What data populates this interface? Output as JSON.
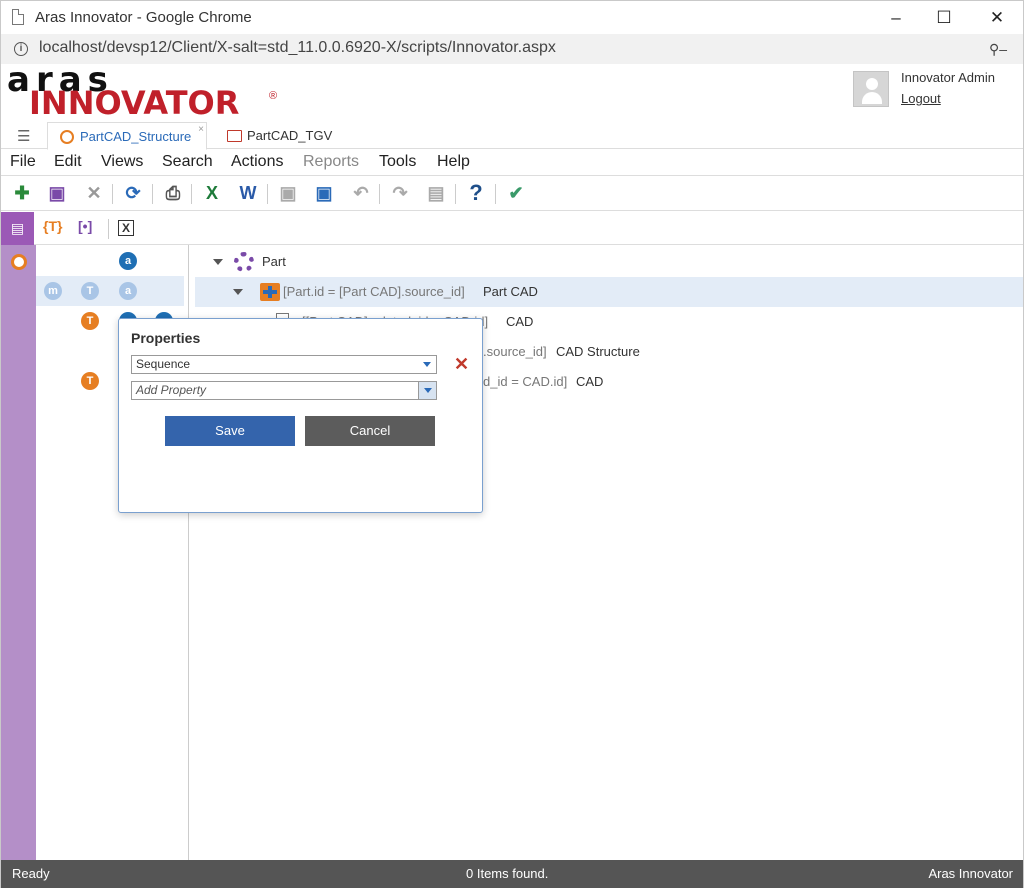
{
  "browser": {
    "title": "Aras Innovator - Google Chrome",
    "url": "localhost/devsp12/Client/X-salt=std_11.0.0.6920-X/scripts/Innovator.aspx"
  },
  "logo": {
    "top": "aras",
    "bottom": "INNOVATOR",
    "reg": "®"
  },
  "user": {
    "name": "Innovator Admin",
    "logout": "Logout"
  },
  "tabs": [
    {
      "label": "PartCAD_Structure",
      "close": "×"
    },
    {
      "label": "PartCAD_TGV"
    }
  ],
  "menu": [
    "File",
    "Edit",
    "Views",
    "Search",
    "Actions",
    "Reports",
    "Tools",
    "Help"
  ],
  "subtoolbar": {
    "t1": "{T}",
    "t2": "[•]",
    "t3": "X"
  },
  "left_icons": {
    "a": "a",
    "m": "m",
    "t": "T"
  },
  "tree": [
    {
      "label": "Part"
    },
    {
      "condition": "[Part.id = [Part CAD].source_id]",
      "label": "Part CAD"
    },
    {
      "condition": "[[Part CAD].related_id = CAD.id]",
      "label": "CAD"
    },
    {
      "condition": ".source_id]",
      "label": "CAD Structure"
    },
    {
      "condition": "d_id = CAD.id]",
      "label": "CAD"
    }
  ],
  "dialog": {
    "title": "Properties",
    "property_value": "Sequence",
    "add_placeholder": "Add Property",
    "remove": "✕",
    "save": "Save",
    "cancel": "Cancel"
  },
  "status": {
    "left": "Ready",
    "center": "0 Items found.",
    "right": "Aras Innovator"
  }
}
